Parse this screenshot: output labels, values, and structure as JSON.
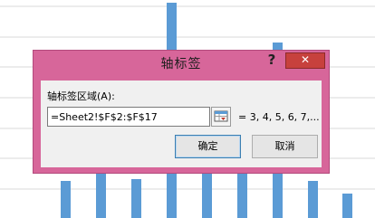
{
  "background_chart": {
    "bar_color": "#5b9bd5",
    "grid_color": "#d9d9d9",
    "type": "bar"
  },
  "dialog": {
    "title": "轴标签",
    "help_label": "?",
    "close_label": "✕",
    "range_label": "轴标签区域(A):",
    "range_value": "=Sheet2!$F$2:$F$17",
    "preview_text": "= 3, 4, 5, 6, 7,...",
    "ok_label": "确定",
    "cancel_label": "取消",
    "frame_color": "#d7669a",
    "close_color": "#c7413d"
  },
  "icons": {
    "collapse_dialog": "range-collapse-icon"
  }
}
